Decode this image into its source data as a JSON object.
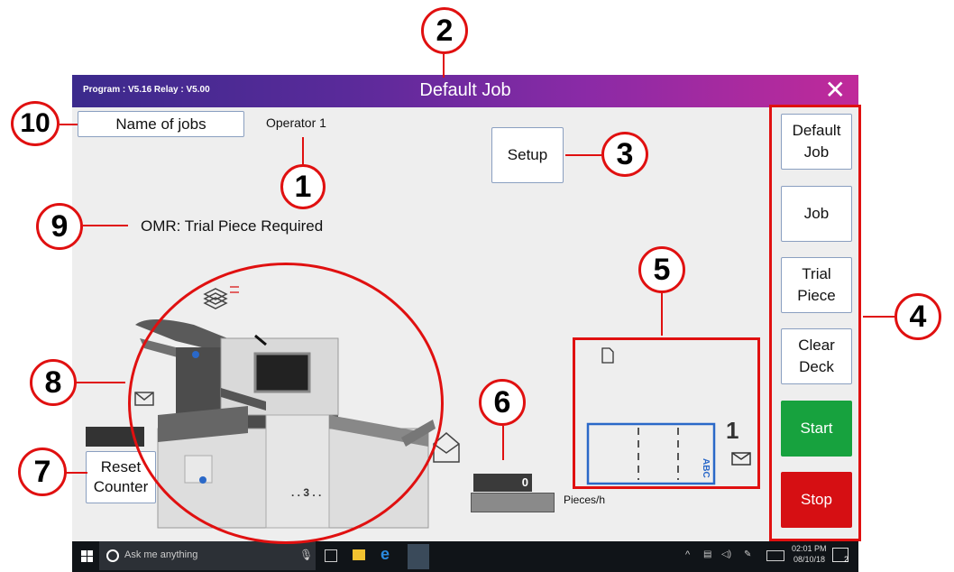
{
  "window": {
    "version": "Program : V5.16   Relay : V5.00",
    "title": "Default Job",
    "close": "✕"
  },
  "main": {
    "job_name": "Name of jobs",
    "operator": "Operator 1",
    "setup": "Setup",
    "omr_status": "OMR: Trial Piece Required",
    "reset_counter": "Reset Counter",
    "counter_value": "0",
    "rate_label": "Pieces/h",
    "machine_station": ". . 3 .  .",
    "envelope_count": "1",
    "envelope_text": "ABC"
  },
  "sidebar": {
    "default_job": "Default Job",
    "job": "Job",
    "trial_piece": "Trial Piece",
    "clear_deck": "Clear Deck",
    "start": "Start",
    "stop": "Stop"
  },
  "taskbar": {
    "search_placeholder": "Ask me anything",
    "time": "02:01 PM",
    "date": "08/10/18",
    "notifications": "2"
  },
  "annotations": [
    "1",
    "2",
    "3",
    "4",
    "5",
    "6",
    "7",
    "8",
    "9",
    "10"
  ],
  "colors": {
    "title_gradient_start": "#3b2a8c",
    "title_gradient_end": "#c02a9a",
    "start": "#17a23e",
    "stop": "#d60f13",
    "annotation": "#e01010"
  }
}
